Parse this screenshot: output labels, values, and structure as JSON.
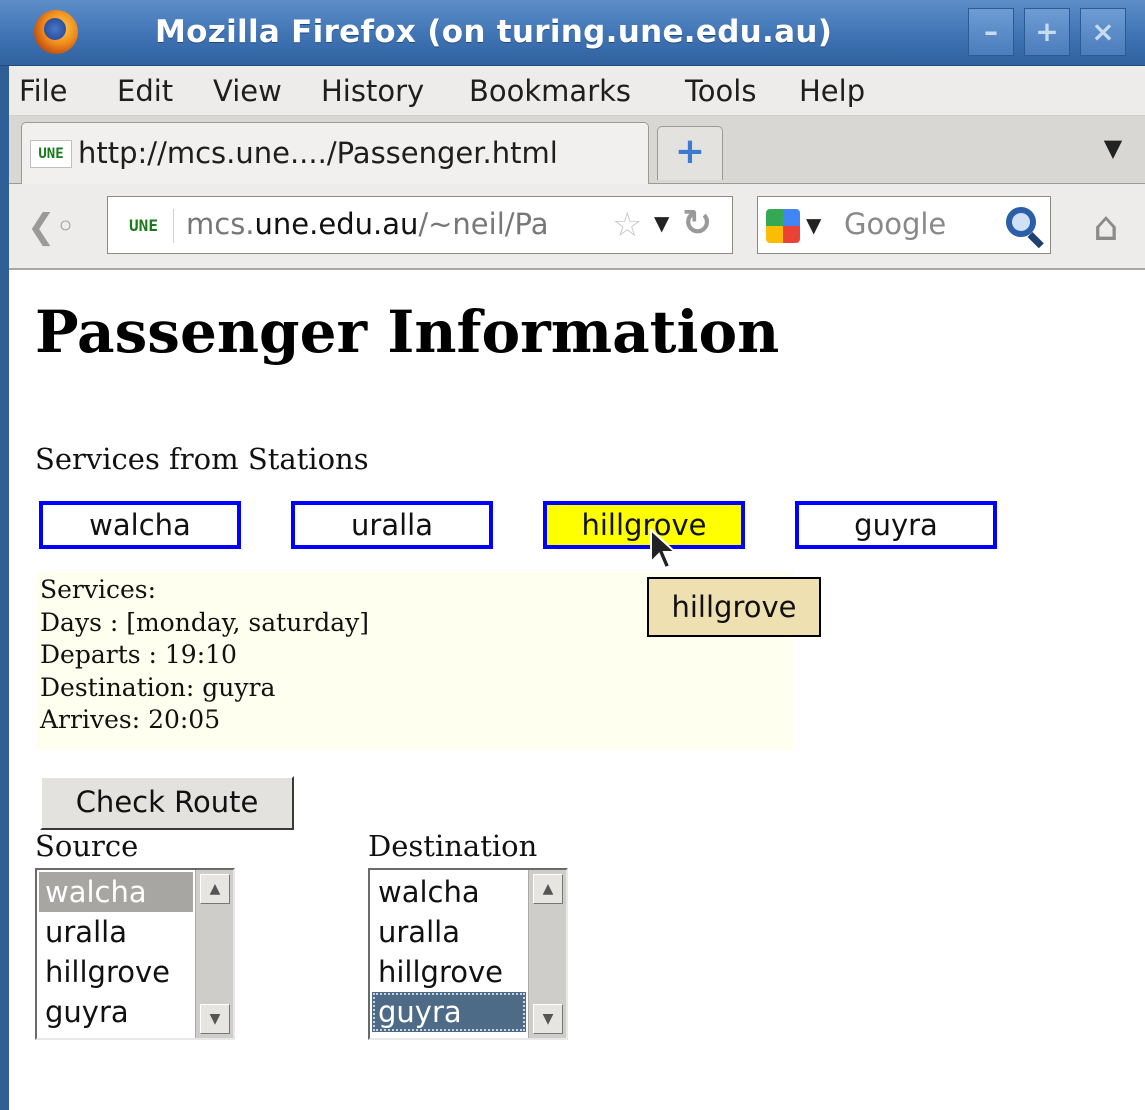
{
  "window": {
    "title": "Mozilla Firefox (on turing.une.edu.au)",
    "min_glyph": "–",
    "max_glyph": "+",
    "close_glyph": "×"
  },
  "menu": {
    "items": [
      {
        "label": "File"
      },
      {
        "label": "Edit"
      },
      {
        "label": "View"
      },
      {
        "label": "History"
      },
      {
        "label": "Bookmarks"
      },
      {
        "label": "Tools"
      },
      {
        "label": "Help"
      }
    ]
  },
  "tabs": {
    "active": {
      "favicon_text": "UNE",
      "title": "http://mcs.une..../Passenger.html"
    },
    "new_tab_glyph": "+",
    "list_glyph": "▼"
  },
  "nav": {
    "url": {
      "favicon_text": "UNE",
      "prefix": "mcs.",
      "host": "une.edu.au",
      "path": "/~neil/Pa"
    },
    "search_placeholder": "Google",
    "icons": [
      "back-icon",
      "star-icon",
      "reload-icon",
      "google-icon",
      "search-icon",
      "home-icon"
    ]
  },
  "page": {
    "title": "Passenger Information",
    "services_label": "Services from Stations",
    "stations": [
      {
        "label": "walcha",
        "active": false
      },
      {
        "label": "uralla",
        "active": false
      },
      {
        "label": "hillgrove",
        "active": true
      },
      {
        "label": "guyra",
        "active": false
      }
    ],
    "tooltip": "hillgrove",
    "services": {
      "heading": "Services:",
      "days": "Days : [monday, saturday]",
      "departs": "Departs : 19:10",
      "destination": "Destination: guyra",
      "arrives": "Arrives: 20:05"
    },
    "check_button": "Check Route",
    "source": {
      "label": "Source",
      "options": [
        "walcha",
        "uralla",
        "hillgrove",
        "guyra"
      ],
      "selected": "walcha"
    },
    "destination": {
      "label": "Destination",
      "options": [
        "walcha",
        "uralla",
        "hillgrove",
        "guyra"
      ],
      "selected": "guyra"
    }
  },
  "colors": {
    "station_border": "#0000ff",
    "station_active_bg": "#ffff00",
    "tooltip_bg": "#efe0b2",
    "services_bg": "#fffff0",
    "titlebar": "#3f73b4"
  }
}
